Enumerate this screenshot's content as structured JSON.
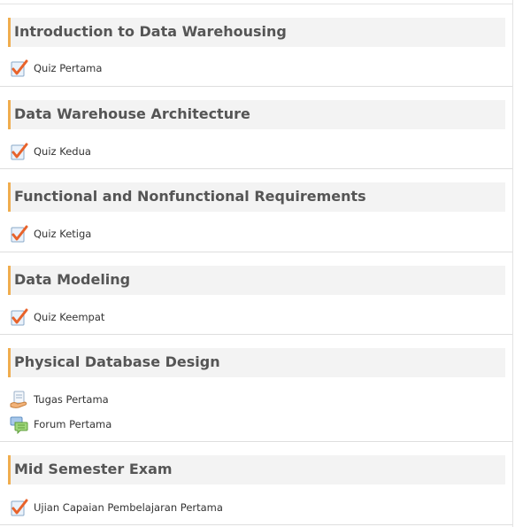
{
  "sections": [
    {
      "title": "Introduction to Data Warehousing",
      "activities": [
        {
          "label": "Quiz Pertama",
          "icon": "quiz-icon"
        }
      ]
    },
    {
      "title": "Data Warehouse Architecture",
      "activities": [
        {
          "label": "Quiz Kedua",
          "icon": "quiz-icon"
        }
      ]
    },
    {
      "title": "Functional and Nonfunctional Requirements",
      "activities": [
        {
          "label": "Quiz Ketiga",
          "icon": "quiz-icon"
        }
      ]
    },
    {
      "title": "Data Modeling",
      "activities": [
        {
          "label": "Quiz Keempat",
          "icon": "quiz-icon"
        }
      ]
    },
    {
      "title": "Physical Database Design",
      "activities": [
        {
          "label": "Tugas Pertama",
          "icon": "assignment-icon"
        },
        {
          "label": "Forum Pertama",
          "icon": "forum-icon"
        }
      ]
    },
    {
      "title": "Mid Semester Exam",
      "activities": [
        {
          "label": "Ujian Capaian Pembelajaran Pertama",
          "icon": "quiz-icon"
        }
      ]
    }
  ],
  "colors": {
    "accent": "#f0ad4e",
    "header_bg": "#f3f3f3",
    "title_text": "#555555",
    "check": "#e8632b"
  }
}
